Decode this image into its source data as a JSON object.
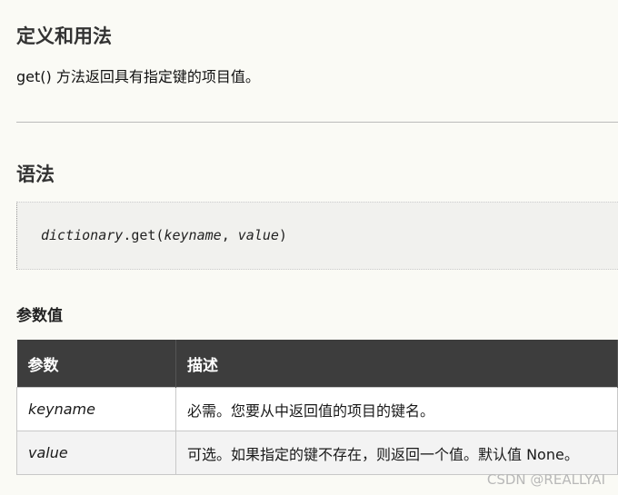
{
  "definition": {
    "heading": "定义和用法",
    "text": "get() 方法返回具有指定键的项目值。"
  },
  "syntax": {
    "heading": "语法",
    "code_object": "dictionary",
    "code_method": ".get(",
    "code_param1": "keyname",
    "code_sep": ", ",
    "code_param2": "value",
    "code_close": ")"
  },
  "params": {
    "heading": "参数值",
    "columns": [
      "参数",
      "描述"
    ],
    "rows": [
      {
        "name": "keyname",
        "description": "必需。您要从中返回值的项目的键名。"
      },
      {
        "name": "value",
        "description": "可选。如果指定的键不存在，则返回一个值。默认值 None。"
      }
    ]
  },
  "watermark": "CSDN @REALLYAI"
}
